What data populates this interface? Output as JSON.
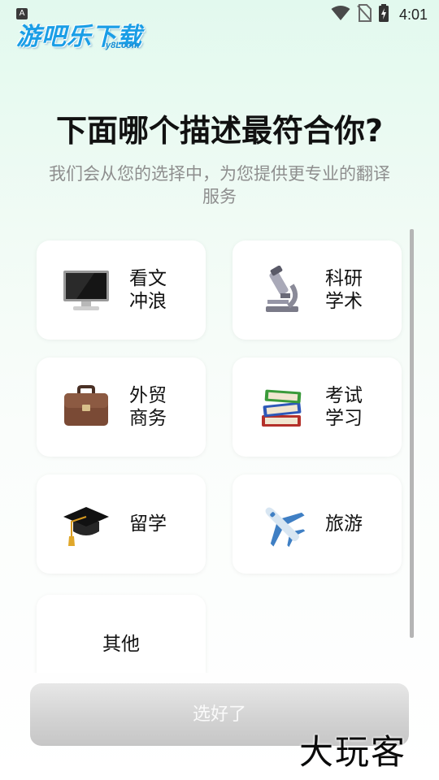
{
  "status_bar": {
    "notification_badge": "A",
    "time": "4:01"
  },
  "logo": {
    "text": "游吧乐下载",
    "subtext": "y8Lcom"
  },
  "header": {
    "title": "下面哪个描述最符合你?",
    "subtitle": "我们会从您的选择中，为您提供更专业的翻译服务"
  },
  "options": [
    {
      "line1": "看文",
      "line2": "冲浪",
      "icon": "computer-icon"
    },
    {
      "line1": "科研",
      "line2": "学术",
      "icon": "microscope-icon"
    },
    {
      "line1": "外贸",
      "line2": "商务",
      "icon": "briefcase-icon"
    },
    {
      "line1": "考试",
      "line2": "学习",
      "icon": "books-icon"
    },
    {
      "line1": "留学",
      "line2": "",
      "icon": "graduation-cap-icon"
    },
    {
      "line1": "旅游",
      "line2": "",
      "icon": "airplane-icon"
    },
    {
      "line1": "其他",
      "line2": "",
      "icon": ""
    }
  ],
  "confirm_button": {
    "label": "选好了"
  },
  "watermark": "大玩客",
  "colors": {
    "accent": "#1a9ee6",
    "button_disabled": "#d3d3d3",
    "subtitle": "#8e8e8e"
  }
}
